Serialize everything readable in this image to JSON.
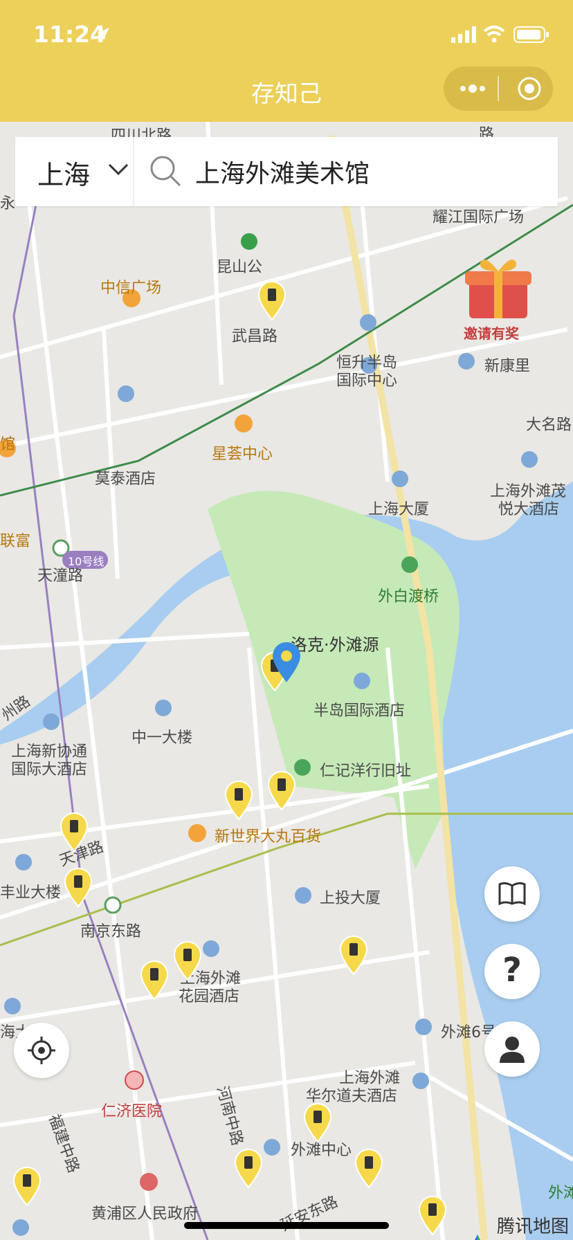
{
  "status": {
    "time": "11:24"
  },
  "nav": {
    "title": "存知己"
  },
  "search": {
    "city": "上海",
    "query": "上海外滩美术馆"
  },
  "promo": {
    "label": "邀请有奖"
  },
  "map_labels": {
    "l1": "耀江国际广场",
    "l2": "中信广场",
    "l3": "昆山公",
    "l4": "武昌路",
    "l5": "恒升半岛",
    "l6": "国际中心",
    "l7": "新康里",
    "l8": "大名路",
    "l9": "星荟中心",
    "l10": "莫泰酒店",
    "l11": "上海大厦",
    "l12": "上海外滩茂",
    "l13": "悦大酒店",
    "l14": "天潼路",
    "l15": "外白渡桥",
    "l16": "10号线",
    "l17": "洛克·外滩源",
    "l18": "半岛国际酒店",
    "l19": "中一大楼",
    "l20": "上海新协通",
    "l21": "国际大酒店",
    "l22": "仁记洋行旧址",
    "l23": "新世界大丸百货",
    "l24": "天津路",
    "l25": "上投大厦",
    "l26": "丰业大楼",
    "l27": "南京东路",
    "l28": "上海外滩",
    "l29": "花园酒店",
    "l30": "外滩6号",
    "l31": "上海外滩",
    "l32": "华尔道夫酒店",
    "l33": "仁济医院",
    "l34": "福建中路",
    "l35": "河南中路",
    "l36": "外滩中心",
    "l37": "黄浦区人民政府",
    "l38": "延安东路",
    "l39": "外滩",
    "l40": "四川北路",
    "l41": "联富",
    "l42": "永",
    "l43": "馆",
    "l44": "州路",
    "l45": "海大",
    "l46": "路"
  },
  "brand": {
    "label": "腾讯地图"
  },
  "colors": {
    "header": "#ecd05a",
    "water": "#a8cdf0",
    "park": "#c6e9b8",
    "pin": "#f5d94a"
  }
}
